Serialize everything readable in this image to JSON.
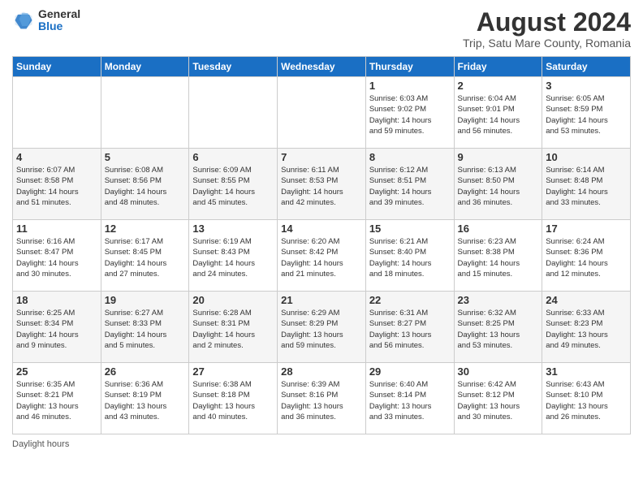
{
  "logo": {
    "general": "General",
    "blue": "Blue"
  },
  "title": "August 2024",
  "subtitle": "Trip, Satu Mare County, Romania",
  "days_header": [
    "Sunday",
    "Monday",
    "Tuesday",
    "Wednesday",
    "Thursday",
    "Friday",
    "Saturday"
  ],
  "weeks": [
    [
      {
        "day": "",
        "info": ""
      },
      {
        "day": "",
        "info": ""
      },
      {
        "day": "",
        "info": ""
      },
      {
        "day": "",
        "info": ""
      },
      {
        "day": "1",
        "info": "Sunrise: 6:03 AM\nSunset: 9:02 PM\nDaylight: 14 hours\nand 59 minutes."
      },
      {
        "day": "2",
        "info": "Sunrise: 6:04 AM\nSunset: 9:01 PM\nDaylight: 14 hours\nand 56 minutes."
      },
      {
        "day": "3",
        "info": "Sunrise: 6:05 AM\nSunset: 8:59 PM\nDaylight: 14 hours\nand 53 minutes."
      }
    ],
    [
      {
        "day": "4",
        "info": "Sunrise: 6:07 AM\nSunset: 8:58 PM\nDaylight: 14 hours\nand 51 minutes."
      },
      {
        "day": "5",
        "info": "Sunrise: 6:08 AM\nSunset: 8:56 PM\nDaylight: 14 hours\nand 48 minutes."
      },
      {
        "day": "6",
        "info": "Sunrise: 6:09 AM\nSunset: 8:55 PM\nDaylight: 14 hours\nand 45 minutes."
      },
      {
        "day": "7",
        "info": "Sunrise: 6:11 AM\nSunset: 8:53 PM\nDaylight: 14 hours\nand 42 minutes."
      },
      {
        "day": "8",
        "info": "Sunrise: 6:12 AM\nSunset: 8:51 PM\nDaylight: 14 hours\nand 39 minutes."
      },
      {
        "day": "9",
        "info": "Sunrise: 6:13 AM\nSunset: 8:50 PM\nDaylight: 14 hours\nand 36 minutes."
      },
      {
        "day": "10",
        "info": "Sunrise: 6:14 AM\nSunset: 8:48 PM\nDaylight: 14 hours\nand 33 minutes."
      }
    ],
    [
      {
        "day": "11",
        "info": "Sunrise: 6:16 AM\nSunset: 8:47 PM\nDaylight: 14 hours\nand 30 minutes."
      },
      {
        "day": "12",
        "info": "Sunrise: 6:17 AM\nSunset: 8:45 PM\nDaylight: 14 hours\nand 27 minutes."
      },
      {
        "day": "13",
        "info": "Sunrise: 6:19 AM\nSunset: 8:43 PM\nDaylight: 14 hours\nand 24 minutes."
      },
      {
        "day": "14",
        "info": "Sunrise: 6:20 AM\nSunset: 8:42 PM\nDaylight: 14 hours\nand 21 minutes."
      },
      {
        "day": "15",
        "info": "Sunrise: 6:21 AM\nSunset: 8:40 PM\nDaylight: 14 hours\nand 18 minutes."
      },
      {
        "day": "16",
        "info": "Sunrise: 6:23 AM\nSunset: 8:38 PM\nDaylight: 14 hours\nand 15 minutes."
      },
      {
        "day": "17",
        "info": "Sunrise: 6:24 AM\nSunset: 8:36 PM\nDaylight: 14 hours\nand 12 minutes."
      }
    ],
    [
      {
        "day": "18",
        "info": "Sunrise: 6:25 AM\nSunset: 8:34 PM\nDaylight: 14 hours\nand 9 minutes."
      },
      {
        "day": "19",
        "info": "Sunrise: 6:27 AM\nSunset: 8:33 PM\nDaylight: 14 hours\nand 5 minutes."
      },
      {
        "day": "20",
        "info": "Sunrise: 6:28 AM\nSunset: 8:31 PM\nDaylight: 14 hours\nand 2 minutes."
      },
      {
        "day": "21",
        "info": "Sunrise: 6:29 AM\nSunset: 8:29 PM\nDaylight: 13 hours\nand 59 minutes."
      },
      {
        "day": "22",
        "info": "Sunrise: 6:31 AM\nSunset: 8:27 PM\nDaylight: 13 hours\nand 56 minutes."
      },
      {
        "day": "23",
        "info": "Sunrise: 6:32 AM\nSunset: 8:25 PM\nDaylight: 13 hours\nand 53 minutes."
      },
      {
        "day": "24",
        "info": "Sunrise: 6:33 AM\nSunset: 8:23 PM\nDaylight: 13 hours\nand 49 minutes."
      }
    ],
    [
      {
        "day": "25",
        "info": "Sunrise: 6:35 AM\nSunset: 8:21 PM\nDaylight: 13 hours\nand 46 minutes."
      },
      {
        "day": "26",
        "info": "Sunrise: 6:36 AM\nSunset: 8:19 PM\nDaylight: 13 hours\nand 43 minutes."
      },
      {
        "day": "27",
        "info": "Sunrise: 6:38 AM\nSunset: 8:18 PM\nDaylight: 13 hours\nand 40 minutes."
      },
      {
        "day": "28",
        "info": "Sunrise: 6:39 AM\nSunset: 8:16 PM\nDaylight: 13 hours\nand 36 minutes."
      },
      {
        "day": "29",
        "info": "Sunrise: 6:40 AM\nSunset: 8:14 PM\nDaylight: 13 hours\nand 33 minutes."
      },
      {
        "day": "30",
        "info": "Sunrise: 6:42 AM\nSunset: 8:12 PM\nDaylight: 13 hours\nand 30 minutes."
      },
      {
        "day": "31",
        "info": "Sunrise: 6:43 AM\nSunset: 8:10 PM\nDaylight: 13 hours\nand 26 minutes."
      }
    ]
  ],
  "footer": {
    "daylight_label": "Daylight hours"
  }
}
